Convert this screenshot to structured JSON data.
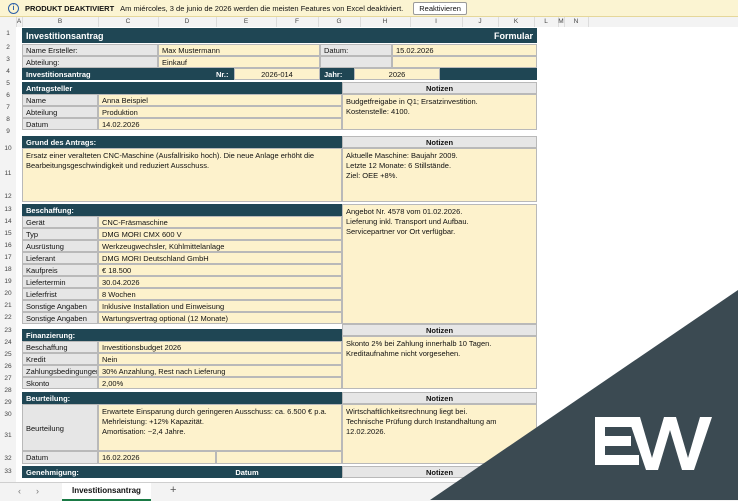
{
  "notice": {
    "icon": "info-icon",
    "title": "PRODUKT DEAKTIVIERT",
    "message": "Am miércoles, 3 de junio de 2026 werden die meisten Features von Excel deaktiviert.",
    "button": "Reaktivieren"
  },
  "columns": [
    "A",
    "B",
    "C",
    "D",
    "E",
    "F",
    "G",
    "H",
    "I",
    "J",
    "K",
    "L",
    "M",
    "N"
  ],
  "rows": [
    "1",
    "2",
    "3",
    "4",
    "5",
    "6",
    "7",
    "8",
    "9",
    "10",
    "11",
    "12",
    "13",
    "14",
    "15",
    "16",
    "17",
    "18",
    "19",
    "20",
    "21",
    "22",
    "23",
    "24",
    "25",
    "26",
    "27",
    "28",
    "29",
    "30",
    "31",
    "32",
    "33"
  ],
  "sheet": {
    "title": "Investitionsantrag",
    "form": "Formular",
    "creator_label": "Name Ersteller:",
    "creator": "Max Mustermann",
    "date_label": "Datum:",
    "date": "15.02.2026",
    "dept_label": "Abteilung:",
    "dept": "Einkauf",
    "request_label": "Investitionsantrag",
    "nr_label": "Nr.:",
    "nr": "2026-014",
    "year_label": "Jahr:",
    "year": "2026",
    "notes": "Notizen"
  },
  "applicant": {
    "header": "Antragsteller",
    "name_label": "Name",
    "name": "Anna Beispiel",
    "dept_label": "Abteilung",
    "dept": "Produktion",
    "date_label": "Datum",
    "date": "14.02.2026",
    "notes": [
      "Budgetfreigabe in Q1; Ersatzinvestition.",
      "Kostenstelle: 4100."
    ]
  },
  "reason": {
    "header": "Grund des Antrags:",
    "text": [
      "Ersatz einer veralteten CNC-Maschine (Ausfallrisiko hoch). Die neue Anlage erhöht die",
      "Bearbeitungsgeschwindigkeit und reduziert Ausschuss."
    ],
    "notes": [
      "Aktuelle Maschine: Baujahr 2009.",
      "Letzte 12 Monate: 6 Stillstände.",
      "Ziel: OEE +8%."
    ]
  },
  "procurement": {
    "header": "Beschaffung:",
    "items": [
      {
        "label": "Gerät",
        "value": "CNC-Fräsmaschine"
      },
      {
        "label": "Typ",
        "value": "DMG MORI CMX 600 V"
      },
      {
        "label": "Ausrüstung",
        "value": "Werkzeugwechsler, Kühlmittelanlage"
      },
      {
        "label": "Lieferant",
        "value": "DMG MORI Deutschland GmbH"
      },
      {
        "label": "Kaufpreis",
        "value": "€ 18.500"
      },
      {
        "label": "Liefertermin",
        "value": "30.04.2026"
      },
      {
        "label": "Lieferfrist",
        "value": "8 Wochen"
      },
      {
        "label": "Sonstige Angaben",
        "value": "Inklusive Installation und Einweisung"
      },
      {
        "label": "Sonstige Angaben",
        "value": "Wartungsvertrag optional (12 Monate)"
      }
    ],
    "notes": [
      "Angebot Nr. 4578 vom 01.02.2026.",
      "Lieferung inkl. Transport und Aufbau.",
      "Servicepartner vor Ort verfügbar."
    ]
  },
  "financing": {
    "header": "Finanzierung:",
    "items": [
      {
        "label": "Beschaffung",
        "value": "Investitionsbudget 2026"
      },
      {
        "label": "Kredit",
        "value": "Nein"
      },
      {
        "label": "Zahlungsbedingungen",
        "value": "30% Anzahlung, Rest nach Lieferung"
      },
      {
        "label": "Skonto",
        "value": "2,00%"
      }
    ],
    "notes": [
      "Skonto 2% bei Zahlung innerhalb 10 Tagen.",
      "Kreditaufnahme nicht vorgesehen."
    ]
  },
  "assessment": {
    "header": "Beurteilung:",
    "label": "Beurteilung",
    "text": [
      "Erwartete Einsparung durch geringeren Ausschuss: ca. 6.500 € p.a.",
      "Mehrleistung: +12% Kapazität.",
      "Amortisation: ~2,4 Jahre."
    ],
    "date_label": "Datum",
    "date": "16.02.2026",
    "notes": [
      "Wirtschaftlichkeitsrechnung liegt bei.",
      "Technische Prüfung durch Instandhaltung am 12.02.2026."
    ]
  },
  "approval": {
    "header": "Genehmigung:",
    "date_col": "Datum"
  },
  "tabs": {
    "active": "Investitionsantrag",
    "add": "+"
  },
  "colors": {
    "header": "#1f4654",
    "value": "#fdf2cc",
    "label": "#e6e6e6",
    "brand": "#3b4a52"
  }
}
